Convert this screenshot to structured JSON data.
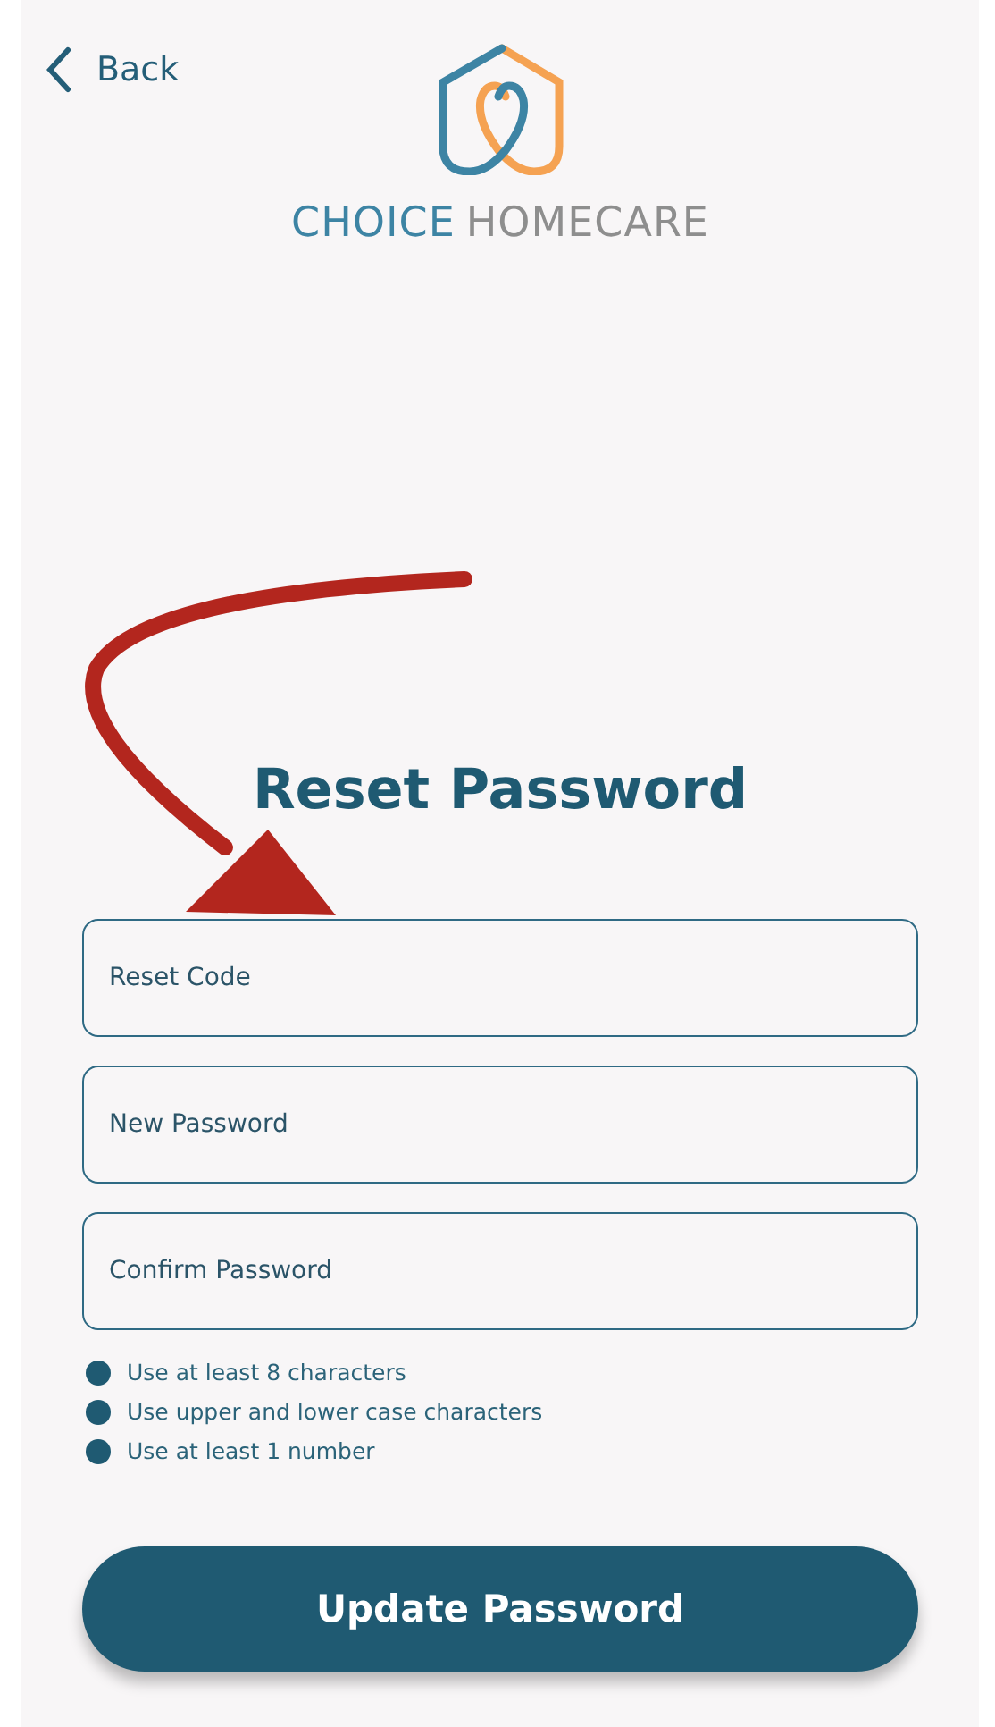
{
  "back": {
    "label": "Back"
  },
  "brand": {
    "first": "CHOICE",
    "second": "HOMECARE"
  },
  "title": "Reset Password",
  "fields": [
    {
      "placeholder": "Reset Code"
    },
    {
      "placeholder": "New Password"
    },
    {
      "placeholder": "Confirm Password"
    }
  ],
  "rules": [
    "Use at least 8 characters",
    "Use upper and lower case characters",
    "Use at least 1 number"
  ],
  "button": "Update Password"
}
